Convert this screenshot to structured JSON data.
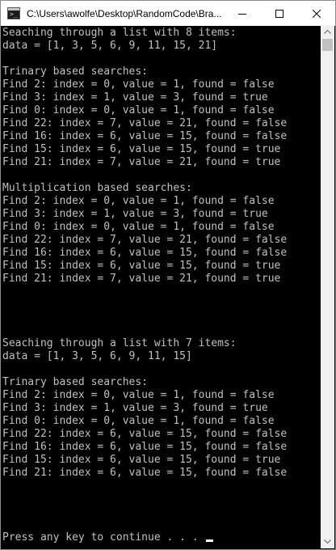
{
  "window": {
    "title": "C:\\Users\\awolfe\\Desktop\\RandomCode\\Bra..."
  },
  "colors": {
    "console_background": "#000000",
    "console_text": "#c0c0c0",
    "titlebar": "#ffffff",
    "scrollbar_track": "#f0f0f0",
    "scrollbar_thumb": "#c1c1c1"
  },
  "icons": {
    "app": "console-app-icon",
    "minimize": "minimize-icon",
    "maximize": "maximize-icon",
    "close": "close-icon",
    "scroll_up": "scroll-up-arrow-icon",
    "scroll_down": "scroll-down-arrow-icon"
  },
  "console": {
    "lines": [
      "Seaching through a list with 8 items:",
      "data = [1, 3, 5, 6, 9, 11, 15, 21]",
      "",
      "Trinary based searches:",
      "Find 2: index = 0, value = 1, found = false",
      "Find 3: index = 1, value = 3, found = true",
      "Find 0: index = 0, value = 1, found = false",
      "Find 22: index = 7, value = 21, found = false",
      "Find 16: index = 6, value = 15, found = false",
      "Find 15: index = 6, value = 15, found = true",
      "Find 21: index = 7, value = 21, found = true",
      "",
      "Multiplication based searches:",
      "Find 2: index = 0, value = 1, found = false",
      "Find 3: index = 1, value = 3, found = true",
      "Find 0: index = 0, value = 1, found = false",
      "Find 22: index = 7, value = 21, found = false",
      "Find 16: index = 6, value = 15, found = false",
      "Find 15: index = 6, value = 15, found = true",
      "Find 21: index = 7, value = 21, found = true",
      "",
      "",
      "",
      "",
      "Seaching through a list with 7 items:",
      "data = [1, 3, 5, 6, 9, 11, 15]",
      "",
      "Trinary based searches:",
      "Find 2: index = 0, value = 1, found = false",
      "Find 3: index = 1, value = 3, found = true",
      "Find 0: index = 0, value = 1, found = false",
      "Find 22: index = 6, value = 15, found = false",
      "Find 16: index = 6, value = 15, found = false",
      "Find 15: index = 6, value = 15, found = true",
      "Find 21: index = 6, value = 15, found = false",
      "",
      "",
      "",
      "",
      "Press any key to continue . . . "
    ]
  }
}
